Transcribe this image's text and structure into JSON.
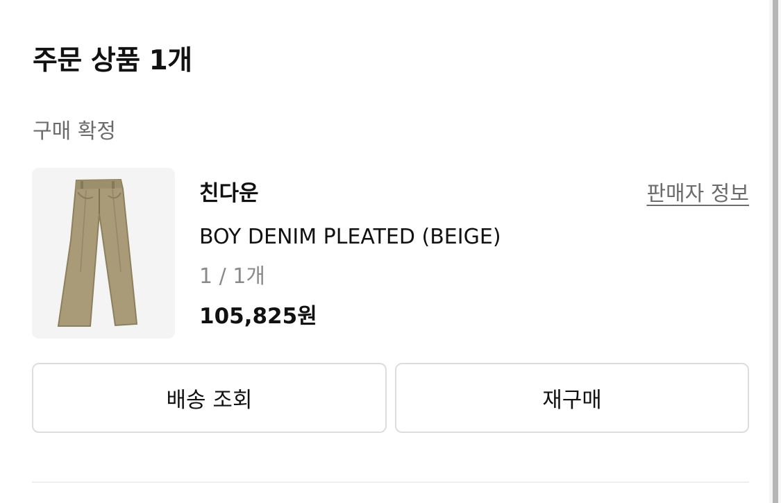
{
  "order_section": {
    "title": "주문 상품 1개",
    "status": "구매 확정"
  },
  "item": {
    "image_icon": "beige-pleated-pants-image",
    "brand": "친다운",
    "seller_info_link": "판매자 정보",
    "product_name": "BOY DENIM PLEATED (BEIGE)",
    "quantity": "1 / 1개",
    "price": "105,825원"
  },
  "actions": {
    "tracking_label": "배송 조회",
    "reorder_label": "재구매"
  },
  "colors": {
    "product": "#a99b77",
    "text": "#111111",
    "muted": "#6b6b6b",
    "border": "#dddddd"
  }
}
